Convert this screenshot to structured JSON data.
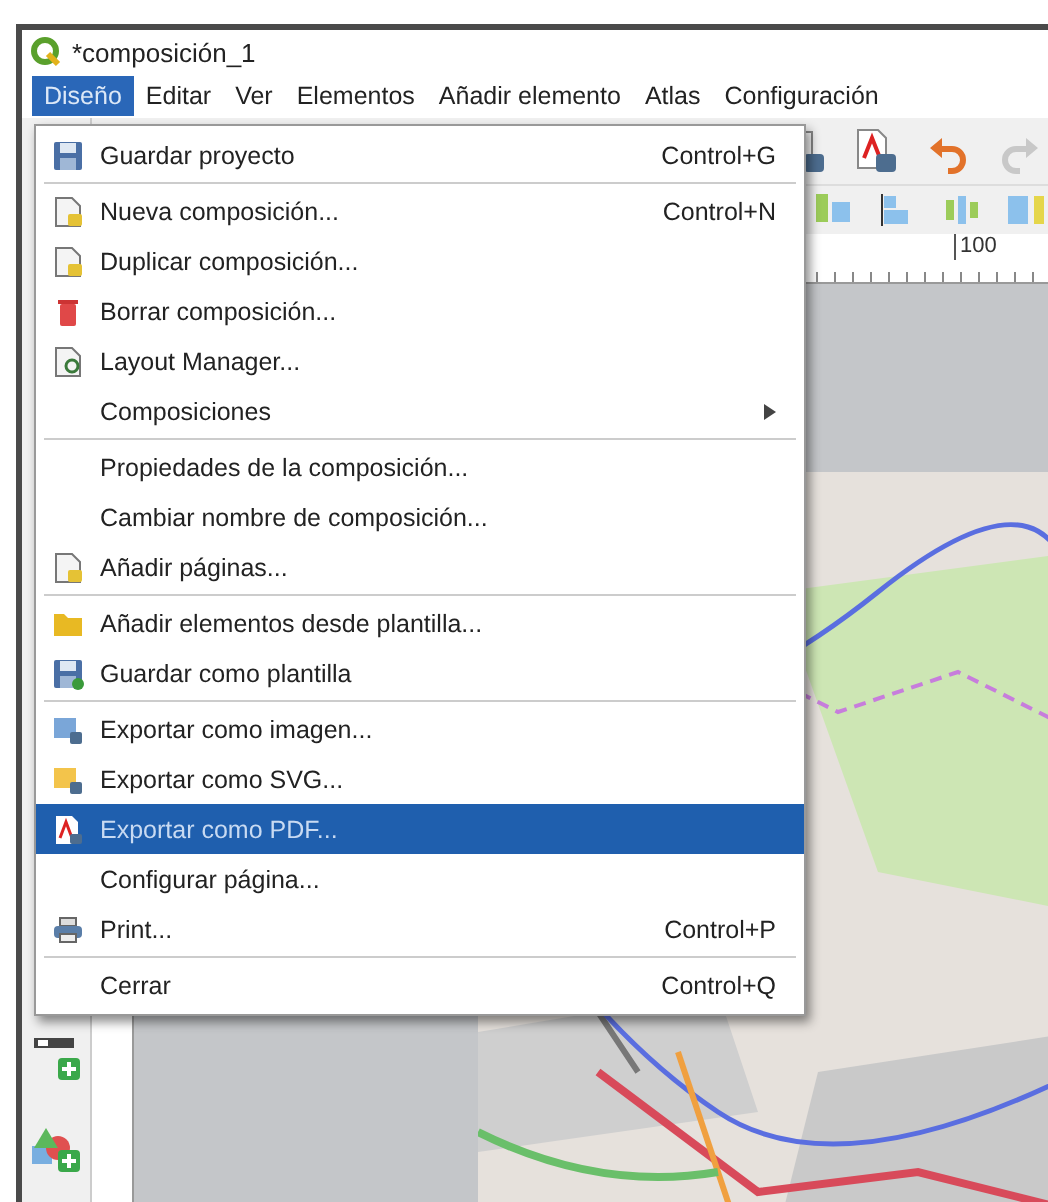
{
  "window": {
    "title": "*composición_1"
  },
  "menubar": [
    {
      "label": "Diseño",
      "selected": true
    },
    {
      "label": "Editar",
      "selected": false
    },
    {
      "label": "Ver",
      "selected": false
    },
    {
      "label": "Elementos",
      "selected": false
    },
    {
      "label": "Añadir elemento",
      "selected": false
    },
    {
      "label": "Atlas",
      "selected": false
    },
    {
      "label": "Configuración",
      "selected": false
    }
  ],
  "menu": {
    "items": [
      {
        "kind": "action",
        "label": "Guardar proyecto",
        "shortcut": "Control+G",
        "selected": false,
        "separator_after": true
      },
      {
        "kind": "action",
        "label": "Nueva composición...",
        "shortcut": "Control+N",
        "selected": false,
        "separator_after": false
      },
      {
        "kind": "action",
        "label": "Duplicar composición...",
        "selected": false,
        "separator_after": false
      },
      {
        "kind": "action",
        "label": "Borrar composición...",
        "selected": false,
        "separator_after": false
      },
      {
        "kind": "action",
        "label": "Layout Manager...",
        "selected": false,
        "separator_after": false
      },
      {
        "kind": "submenu",
        "label": "Composiciones",
        "selected": false,
        "separator_after": true
      },
      {
        "kind": "action",
        "label": "Propiedades de la composición...",
        "selected": false,
        "separator_after": false
      },
      {
        "kind": "action",
        "label": "Cambiar nombre de composición...",
        "selected": false,
        "separator_after": false
      },
      {
        "kind": "action",
        "label": "Añadir páginas...",
        "selected": false,
        "separator_after": true
      },
      {
        "kind": "action",
        "label": "Añadir elementos desde plantilla...",
        "selected": false,
        "separator_after": false
      },
      {
        "kind": "action",
        "label": "Guardar como plantilla",
        "selected": false,
        "separator_after": true
      },
      {
        "kind": "action",
        "label": "Exportar como imagen...",
        "selected": false,
        "separator_after": false
      },
      {
        "kind": "action",
        "label": "Exportar como SVG...",
        "selected": false,
        "separator_after": false
      },
      {
        "kind": "action",
        "label": "Exportar como PDF...",
        "selected": true,
        "separator_after": false
      },
      {
        "kind": "action",
        "label": "Configurar página...",
        "selected": false,
        "separator_after": false
      },
      {
        "kind": "action",
        "label": "Print...",
        "shortcut": "Control+P",
        "selected": false,
        "separator_after": true
      },
      {
        "kind": "action",
        "label": "Cerrar",
        "shortcut": "Control+Q",
        "selected": false,
        "separator_after": false
      }
    ]
  },
  "ruler": {
    "label": "100"
  }
}
